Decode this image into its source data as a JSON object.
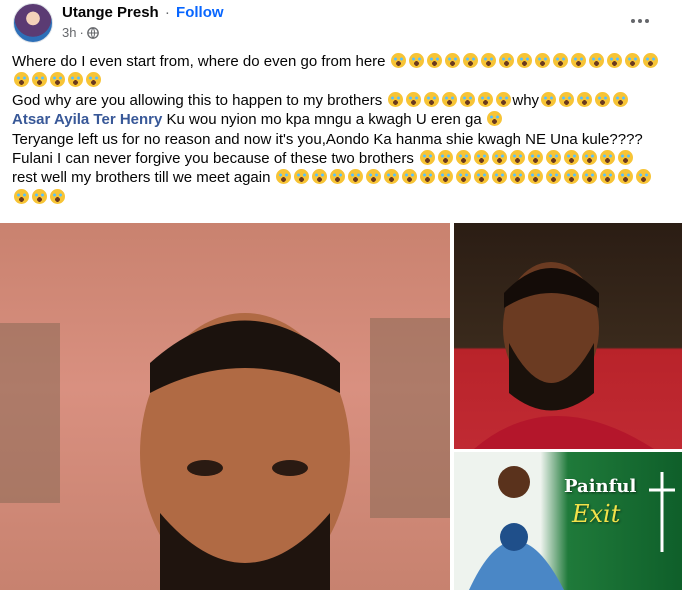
{
  "header": {
    "author": "Utange Presh",
    "separator": "·",
    "follow_label": "Follow",
    "timestamp": "3h",
    "meta_separator": "·",
    "audience_icon": "globe-icon",
    "more_icon": "more-options-icon"
  },
  "post": {
    "lines": [
      {
        "text": "Where do I even start from, where do even go from here",
        "emoji_count": 15
      },
      {
        "text": "",
        "emoji_count": 5
      },
      {
        "text": "God why are you allowing this to happen to my brothers",
        "emoji_count": 7,
        "suffix": "why",
        "suffix_emoji_count": 5
      },
      {
        "mention": "Atsar Ayila Ter Henry",
        "text": " Ku wou nyion mo kpa mngu a kwagh U eren ga",
        "emoji_count": 1
      },
      {
        "text": "Teryange left us for no reason and now it's you,Aondo Ka hanma shie kwagh NE Una kule????",
        "emoji_count": 0
      },
      {
        "text": "Fulani I can never forgive you because of these two brothers",
        "emoji_count": 12
      },
      {
        "text": "rest well my brothers till we meet again",
        "emoji_count": 21
      },
      {
        "text": "",
        "emoji_count": 3
      }
    ],
    "emoji_name": "loudly-crying-face"
  },
  "photos": {
    "main_alt": "portrait photo of young man",
    "top_right_alt": "photo of young man in red shirt",
    "bottom_right_caption_1": "Painful",
    "bottom_right_caption_2": "Exit"
  },
  "colors": {
    "link": "#385898",
    "follow": "#0866ff",
    "secondary": "#65676b",
    "text": "#050505"
  }
}
